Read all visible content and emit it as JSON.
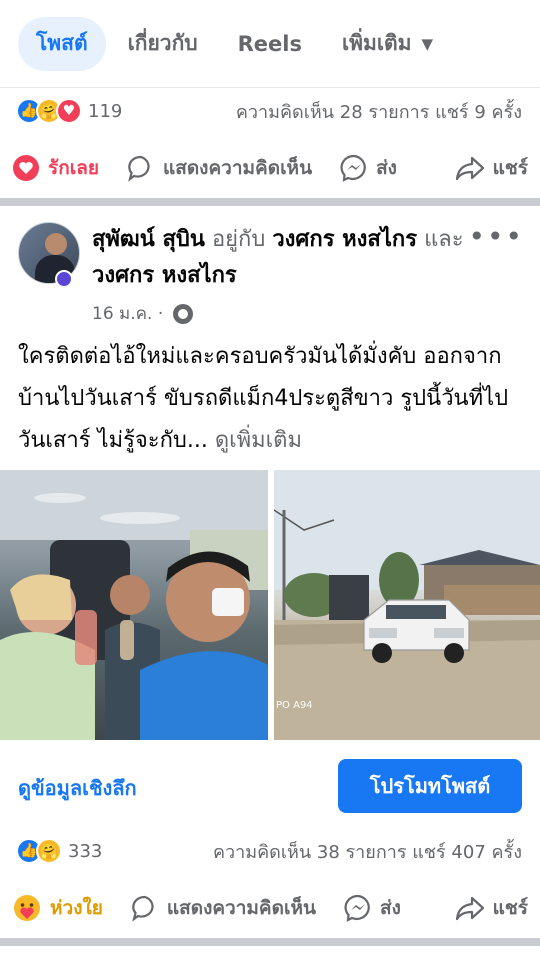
{
  "tabs": [
    {
      "label": "โพสต์",
      "active": true
    },
    {
      "label": "เกี่ยวกับ",
      "active": false
    },
    {
      "label": "Reels",
      "active": false
    },
    {
      "label": "เพิ่มเติม",
      "active": false
    }
  ],
  "post1": {
    "reaction_count": "119",
    "summary": "ความคิดเห็น 28 รายการ  แชร์ 9 ครั้ง",
    "actions": {
      "react": "รักเลย",
      "comment": "แสดงความคิดเห็น",
      "send": "ส่ง",
      "share": "แชร์"
    }
  },
  "post2": {
    "author": "สุพัฒน์ สุบิน",
    "with_word": "อยู่กับ",
    "tag1": "วงศกร หงสไกร",
    "and_word": "และ",
    "tag2": "วงศกร หงสไกร",
    "date": "16 ม.ค. ·",
    "text": "ใครติดต่อไอ้ใหม่และครอบครัวมันได้มั่งคับ ออกจากบ้านไปวันเสาร์  ขับรถดีแม็ก4ประตูสีขาว รูปนี้วันที่ไปวันเสาร์ ไม่รู้จะกับ...",
    "see_more": " ดูเพิ่มเติม",
    "insights": "ดูข้อมูลเชิงลึก",
    "promote": "โปรโมทโพสต์",
    "reaction_count": "333",
    "summary": "ความคิดเห็น 38 รายการ  แชร์ 407 ครั้ง",
    "actions": {
      "react": "ห่วงใย",
      "comment": "แสดงความคิดเห็น",
      "send": "ส่ง",
      "share": "แชร์"
    },
    "photo2_watermark": "PO A94"
  },
  "colors": {
    "accent": "#1877f2",
    "love": "#f33e58",
    "care": "#f7b928"
  }
}
